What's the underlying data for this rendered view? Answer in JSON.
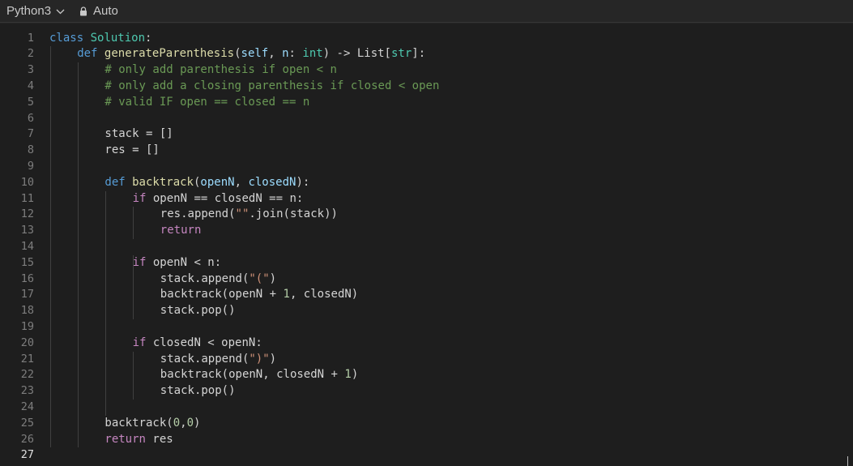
{
  "toolbar": {
    "language": "Python3",
    "mode": "Auto"
  },
  "editor": {
    "active_line": 27,
    "lines": [
      {
        "n": "1",
        "indent": 0,
        "tokens": [
          [
            "k",
            "class"
          ],
          [
            "p",
            " "
          ],
          [
            "cls",
            "Solution"
          ],
          [
            "p",
            ":"
          ]
        ]
      },
      {
        "n": "2",
        "indent": 1,
        "tokens": [
          [
            "k",
            "def"
          ],
          [
            "p",
            " "
          ],
          [
            "fn",
            "generateParenthesis"
          ],
          [
            "p",
            "("
          ],
          [
            "v",
            "self"
          ],
          [
            "p",
            ", "
          ],
          [
            "v",
            "n"
          ],
          [
            "p",
            ": "
          ],
          [
            "cls",
            "int"
          ],
          [
            "p",
            ") -> List["
          ],
          [
            "cls",
            "str"
          ],
          [
            "p",
            "]:"
          ]
        ]
      },
      {
        "n": "3",
        "indent": 2,
        "tokens": [
          [
            "c",
            "# only add parenthesis if open < n"
          ]
        ]
      },
      {
        "n": "4",
        "indent": 2,
        "tokens": [
          [
            "c",
            "# only add a closing parenthesis if closed < open"
          ]
        ]
      },
      {
        "n": "5",
        "indent": 2,
        "tokens": [
          [
            "c",
            "# valid IF open == closed == n"
          ]
        ]
      },
      {
        "n": "6",
        "indent": 0,
        "tokens": []
      },
      {
        "n": "7",
        "indent": 2,
        "tokens": [
          [
            "p",
            "stack = []"
          ]
        ]
      },
      {
        "n": "8",
        "indent": 2,
        "tokens": [
          [
            "p",
            "res = []"
          ]
        ]
      },
      {
        "n": "9",
        "indent": 0,
        "tokens": []
      },
      {
        "n": "10",
        "indent": 2,
        "tokens": [
          [
            "k",
            "def"
          ],
          [
            "p",
            " "
          ],
          [
            "fn",
            "backtrack"
          ],
          [
            "p",
            "("
          ],
          [
            "v",
            "openN"
          ],
          [
            "p",
            ", "
          ],
          [
            "v",
            "closedN"
          ],
          [
            "p",
            "):"
          ]
        ]
      },
      {
        "n": "11",
        "indent": 3,
        "tokens": [
          [
            "kc",
            "if"
          ],
          [
            "p",
            " openN == closedN == n:"
          ]
        ]
      },
      {
        "n": "12",
        "indent": 4,
        "tokens": [
          [
            "p",
            "res.append("
          ],
          [
            "s",
            "\"\""
          ],
          [
            "p",
            ".join(stack))"
          ]
        ]
      },
      {
        "n": "13",
        "indent": 4,
        "tokens": [
          [
            "kc",
            "return"
          ]
        ]
      },
      {
        "n": "14",
        "indent": 0,
        "tokens": []
      },
      {
        "n": "15",
        "indent": 3,
        "tokens": [
          [
            "kc",
            "if"
          ],
          [
            "p",
            " openN < n:"
          ]
        ]
      },
      {
        "n": "16",
        "indent": 4,
        "tokens": [
          [
            "p",
            "stack.append("
          ],
          [
            "s",
            "\"(\""
          ],
          [
            "p",
            ")"
          ]
        ]
      },
      {
        "n": "17",
        "indent": 4,
        "tokens": [
          [
            "p",
            "backtrack(openN + "
          ],
          [
            "n",
            "1"
          ],
          [
            "p",
            ", closedN)"
          ]
        ]
      },
      {
        "n": "18",
        "indent": 4,
        "tokens": [
          [
            "p",
            "stack.pop()"
          ]
        ]
      },
      {
        "n": "19",
        "indent": 0,
        "tokens": []
      },
      {
        "n": "20",
        "indent": 3,
        "tokens": [
          [
            "kc",
            "if"
          ],
          [
            "p",
            " closedN < openN:"
          ]
        ]
      },
      {
        "n": "21",
        "indent": 4,
        "tokens": [
          [
            "p",
            "stack.append("
          ],
          [
            "s",
            "\")\""
          ],
          [
            "p",
            ")"
          ]
        ]
      },
      {
        "n": "22",
        "indent": 4,
        "tokens": [
          [
            "p",
            "backtrack(openN, closedN + "
          ],
          [
            "n",
            "1"
          ],
          [
            "p",
            ")"
          ]
        ]
      },
      {
        "n": "23",
        "indent": 4,
        "tokens": [
          [
            "p",
            "stack.pop()"
          ]
        ]
      },
      {
        "n": "24",
        "indent": 0,
        "tokens": []
      },
      {
        "n": "25",
        "indent": 2,
        "tokens": [
          [
            "p",
            "backtrack("
          ],
          [
            "n",
            "0"
          ],
          [
            "p",
            ","
          ],
          [
            "n",
            "0"
          ],
          [
            "p",
            ")"
          ]
        ]
      },
      {
        "n": "26",
        "indent": 2,
        "tokens": [
          [
            "kc",
            "return"
          ],
          [
            "p",
            " res"
          ]
        ]
      },
      {
        "n": "27",
        "indent": 0,
        "tokens": []
      }
    ]
  },
  "icons": {
    "language_dropdown": "chevron-down-icon",
    "mode_lock": "lock-icon"
  }
}
